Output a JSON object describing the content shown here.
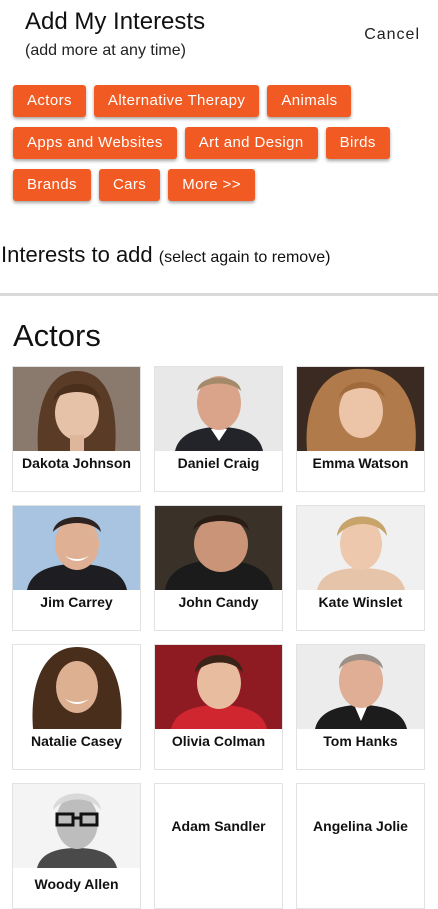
{
  "header": {
    "title": "Add My Interests",
    "subtitle": "(add more at any time)",
    "cancel_label": "Cancel"
  },
  "categories": [
    "Actors",
    "Alternative Therapy",
    "Animals",
    "Apps and Websites",
    "Art and Design",
    "Birds",
    "Brands",
    "Cars",
    "More >>"
  ],
  "interests_to_add": {
    "label": "Interests to add",
    "hint": "(select again to remove)"
  },
  "section": {
    "title": "Actors",
    "people": [
      {
        "name": "Dakota Johnson"
      },
      {
        "name": "Daniel Craig"
      },
      {
        "name": "Emma Watson"
      },
      {
        "name": "Jim Carrey"
      },
      {
        "name": "John Candy"
      },
      {
        "name": "Kate Winslet"
      },
      {
        "name": "Natalie Casey"
      },
      {
        "name": "Olivia Colman"
      },
      {
        "name": "Tom Hanks"
      },
      {
        "name": "Woody Allen"
      },
      {
        "name": "Adam Sandler"
      },
      {
        "name": "Angelina Jolie"
      }
    ]
  },
  "colors": {
    "chip_bg": "#f15a22",
    "chip_text": "#ffffff",
    "divider": "#d9d9d9"
  }
}
